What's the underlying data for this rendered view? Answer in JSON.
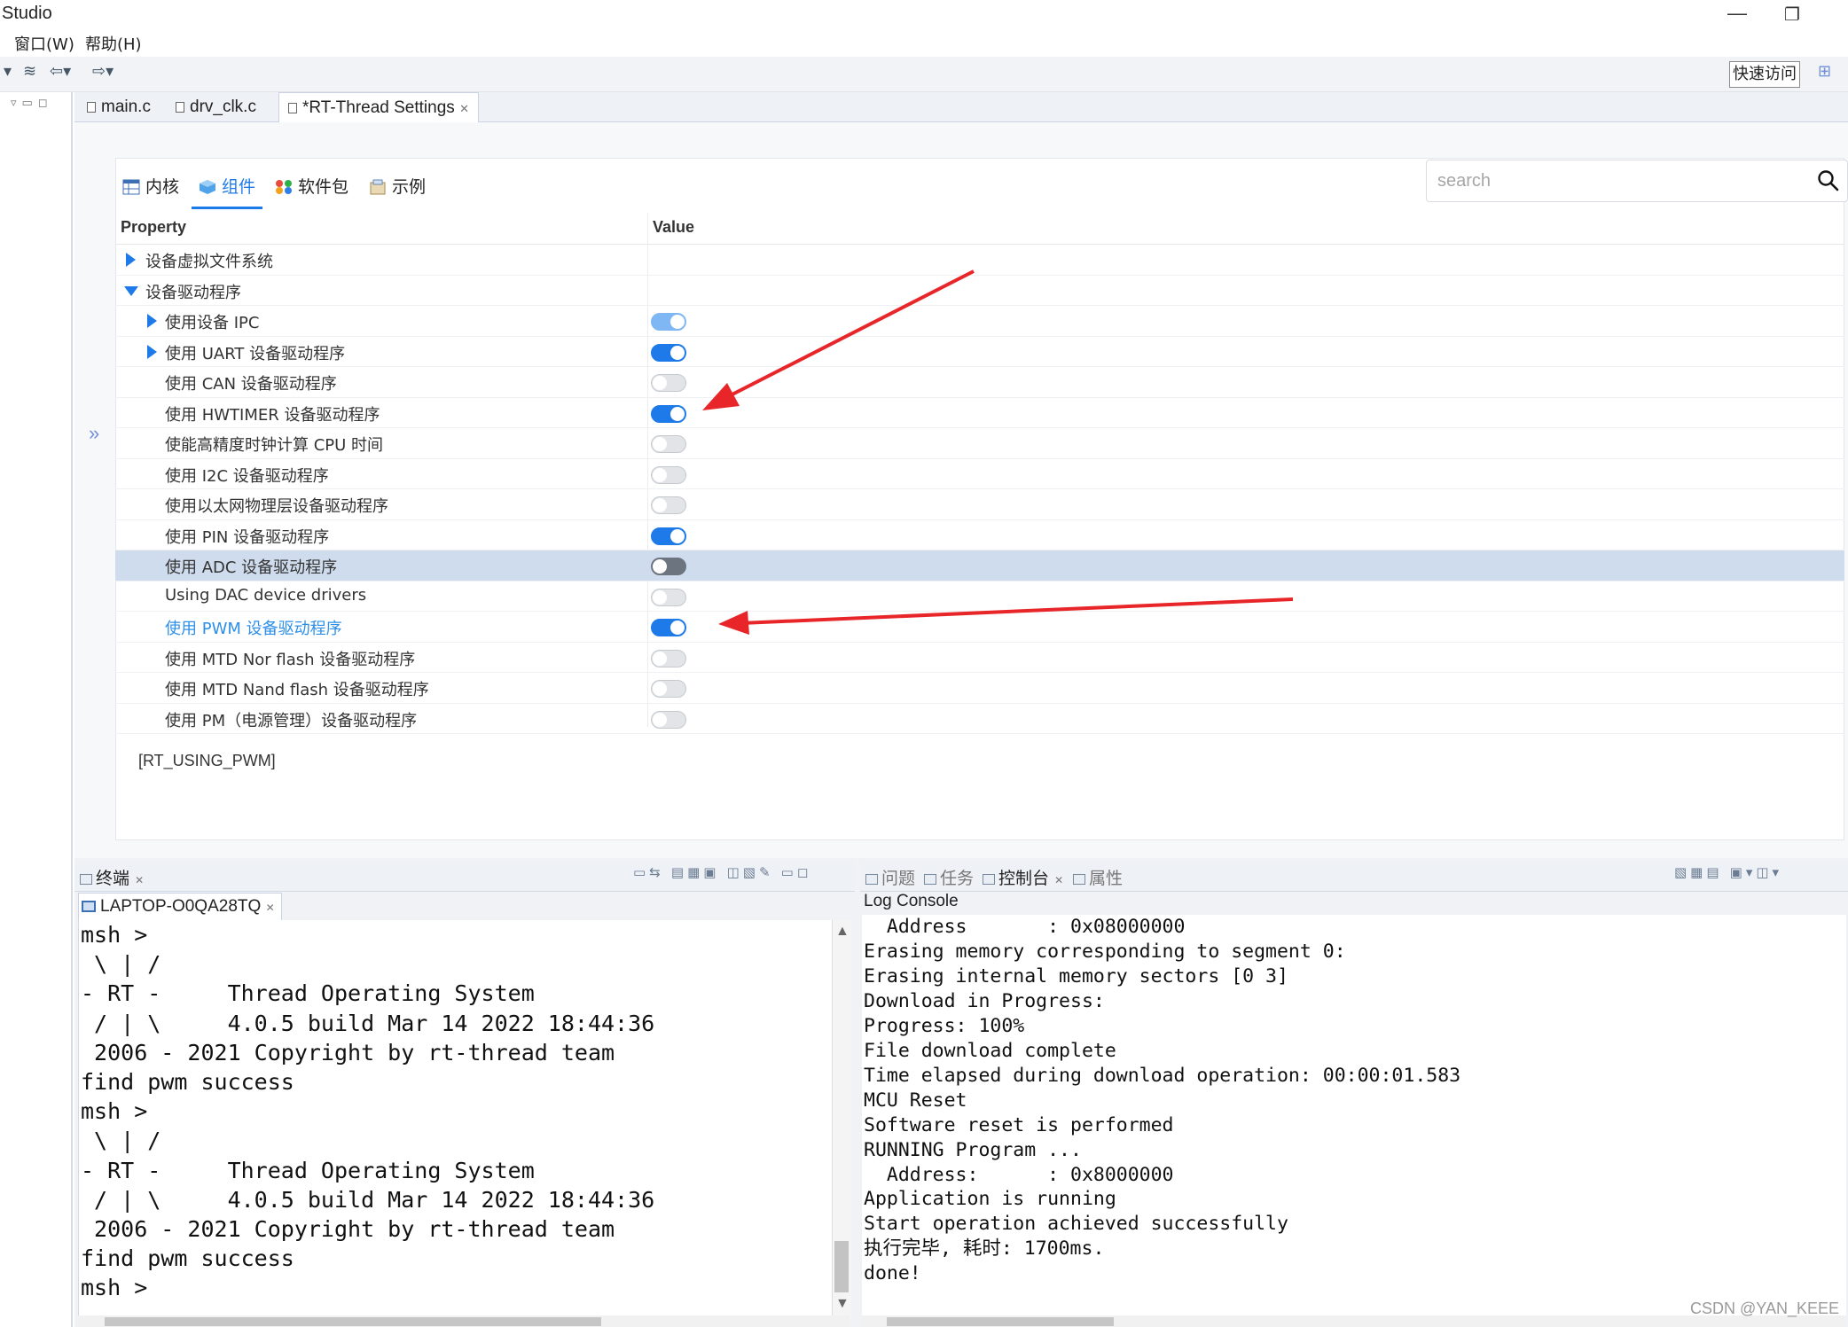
{
  "window": {
    "title": "Studio",
    "minimize_glyph": "—",
    "restore_glyph": "❐"
  },
  "menu": {
    "items": [
      "窗口(W)",
      "帮助(H)"
    ]
  },
  "toolbar": {
    "quick_access_label": "快速访问"
  },
  "editor_tabs": [
    {
      "label": "main.c",
      "active": false
    },
    {
      "label": "drv_clk.c",
      "active": false
    },
    {
      "label": "*RT-Thread Settings",
      "active": true,
      "close": "✕"
    }
  ],
  "settings": {
    "tabs": [
      {
        "label": "内核",
        "icon": "table-icon",
        "active": false
      },
      {
        "label": "组件",
        "icon": "cube-icon",
        "active": true
      },
      {
        "label": "软件包",
        "icon": "packages-icon",
        "active": false
      },
      {
        "label": "示例",
        "icon": "samples-icon",
        "active": false
      }
    ],
    "search": {
      "placeholder": "search",
      "icon": "search-icon"
    },
    "columns": {
      "property": "Property",
      "value": "Value"
    },
    "rows": [
      {
        "label": "设备虚拟文件系统",
        "indent": 0,
        "expander": "right",
        "toggle": null
      },
      {
        "label": "设备驱动程序",
        "indent": 0,
        "expander": "down",
        "toggle": null
      },
      {
        "label": "使用设备 IPC",
        "indent": 1,
        "expander": "right",
        "toggle": "on-light"
      },
      {
        "label": "使用 UART 设备驱动程序",
        "indent": 1,
        "expander": "right",
        "toggle": "on"
      },
      {
        "label": "使用 CAN 设备驱动程序",
        "indent": 1,
        "expander": null,
        "toggle": "off"
      },
      {
        "label": "使用 HWTIMER 设备驱动程序",
        "indent": 1,
        "expander": null,
        "toggle": "on"
      },
      {
        "label": "使能高精度时钟计算 CPU 时间",
        "indent": 1,
        "expander": null,
        "toggle": "off"
      },
      {
        "label": "使用 I2C 设备驱动程序",
        "indent": 1,
        "expander": null,
        "toggle": "off"
      },
      {
        "label": "使用以太网物理层设备驱动程序",
        "indent": 1,
        "expander": null,
        "toggle": "off"
      },
      {
        "label": "使用 PIN 设备驱动程序",
        "indent": 1,
        "expander": null,
        "toggle": "on"
      },
      {
        "label": "使用 ADC 设备驱动程序",
        "indent": 1,
        "expander": null,
        "toggle": "off",
        "selected": true
      },
      {
        "label": "Using DAC device drivers",
        "indent": 1,
        "expander": null,
        "toggle": "off"
      },
      {
        "label": "使用 PWM 设备驱动程序",
        "indent": 1,
        "expander": null,
        "toggle": "on",
        "link": true
      },
      {
        "label": "使用 MTD Nor flash 设备驱动程序",
        "indent": 1,
        "expander": null,
        "toggle": "off"
      },
      {
        "label": "使用 MTD Nand flash 设备驱动程序",
        "indent": 1,
        "expander": null,
        "toggle": "off"
      },
      {
        "label": "使用 PM（电源管理）设备驱动程序",
        "indent": 1,
        "expander": null,
        "toggle": "off"
      }
    ],
    "macro": "[RT_USING_PWM]",
    "expand_glyph": "»"
  },
  "terminal_view": {
    "tab_label": "终端",
    "session_label": "LAPTOP-O0QA28TQ",
    "lines": [
      "msh >",
      " \\ | /",
      "- RT -     Thread Operating System",
      " / | \\     4.0.5 build Mar 14 2022 18:44:36",
      " 2006 - 2021 Copyright by rt-thread team",
      "find pwm success",
      "msh >",
      " \\ | /",
      "- RT -     Thread Operating System",
      " / | \\     4.0.5 build Mar 14 2022 18:44:36",
      " 2006 - 2021 Copyright by rt-thread team",
      "find pwm success",
      "msh >"
    ]
  },
  "console_view": {
    "tabs": [
      {
        "label": "问题",
        "active": false
      },
      {
        "label": "任务",
        "active": false
      },
      {
        "label": "控制台",
        "active": true
      },
      {
        "label": "属性",
        "active": false
      }
    ],
    "title": "Log Console",
    "lines": [
      "  Address       : 0x08000000",
      "Erasing memory corresponding to segment 0:",
      "Erasing internal memory sectors [0 3]",
      "Download in Progress:",
      "Progress: 100%",
      "File download complete",
      "Time elapsed during download operation: 00:00:01.583",
      "MCU Reset",
      "Software reset is performed",
      "RUNNING Program ...",
      "  Address:      : 0x8000000",
      "Application is running",
      "Start operation achieved successfully",
      "执行完毕, 耗时: 1700ms.",
      "done!"
    ]
  },
  "watermark": "CSDN @YAN_KEEE",
  "colors": {
    "accent": "#1e7ae8",
    "annotation_arrow": "#e8262a",
    "selection": "#cfdced"
  }
}
